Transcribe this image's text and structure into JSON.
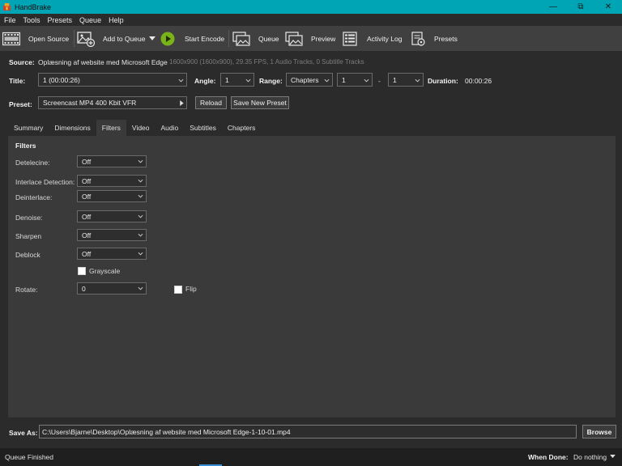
{
  "window": {
    "title": "HandBrake",
    "minimize": "—",
    "maximize": "⧉",
    "close": "✕"
  },
  "menu": [
    "File",
    "Tools",
    "Presets",
    "Queue",
    "Help"
  ],
  "toolbar": {
    "open_source": "Open Source",
    "add_to_queue": "Add to Queue",
    "start_encode": "Start Encode",
    "queue": "Queue",
    "preview": "Preview",
    "activity_log": "Activity Log",
    "presets": "Presets"
  },
  "source": {
    "label": "Source:",
    "name": "Oplæsning af website med Microsoft Edge",
    "info": "1600x900 (1600x900), 29.35 FPS, 1 Audio Tracks, 0 Subtitle Tracks"
  },
  "title_row": {
    "title_label": "Title:",
    "title_value": "1  (00:00:26)",
    "angle_label": "Angle:",
    "angle_value": "1",
    "range_label": "Range:",
    "range_type": "Chapters",
    "range_start": "1",
    "range_sep": "-",
    "range_end": "1",
    "duration_label": "Duration:",
    "duration_value": "00:00:26"
  },
  "preset": {
    "label": "Preset:",
    "value": "Screencast MP4 400 Kbit VFR",
    "reload": "Reload",
    "save_new": "Save New Preset"
  },
  "tabs": [
    "Summary",
    "Dimensions",
    "Filters",
    "Video",
    "Audio",
    "Subtitles",
    "Chapters"
  ],
  "active_tab": "Filters",
  "filters": {
    "heading": "Filters",
    "detelecine_label": "Detelecine:",
    "detelecine_value": "Off",
    "interlace_label": "Interlace Detection:",
    "interlace_value": "Off",
    "deinterlace_label": "Deinterlace:",
    "deinterlace_value": "Off",
    "denoise_label": "Denoise:",
    "denoise_value": "Off",
    "sharpen_label": "Sharpen",
    "sharpen_value": "Off",
    "deblock_label": "Deblock",
    "deblock_value": "Off",
    "grayscale_label": "Grayscale",
    "rotate_label": "Rotate:",
    "rotate_value": "0",
    "flip_label": "Flip"
  },
  "save_as": {
    "label": "Save As:",
    "path": "C:\\Users\\Bjarne\\Desktop\\Oplæsning af website med Microsoft Edge-1-10-01.mp4",
    "browse": "Browse"
  },
  "status": {
    "text": "Queue Finished",
    "when_done_label": "When Done:",
    "when_done_value": "Do nothing"
  },
  "colors": {
    "titlebar": "#00a5b5",
    "background": "#2b2b2b",
    "toolbar": "#404040",
    "panel": "#3a3a3a",
    "start_icon": "#7ab317"
  }
}
